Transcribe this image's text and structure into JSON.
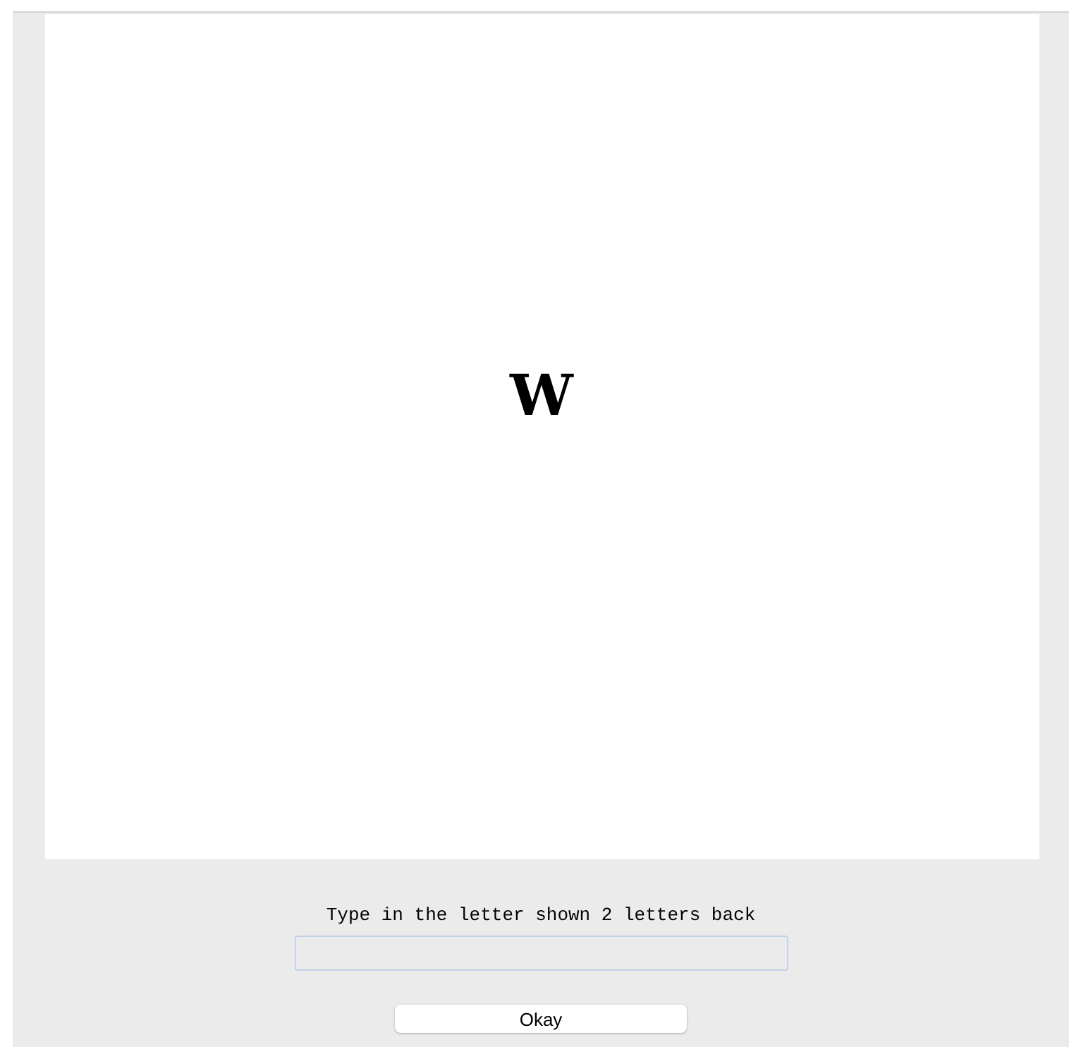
{
  "stimulus": {
    "letter": "W"
  },
  "prompt": "Type in the letter shown 2 letters back",
  "button": "Okay"
}
